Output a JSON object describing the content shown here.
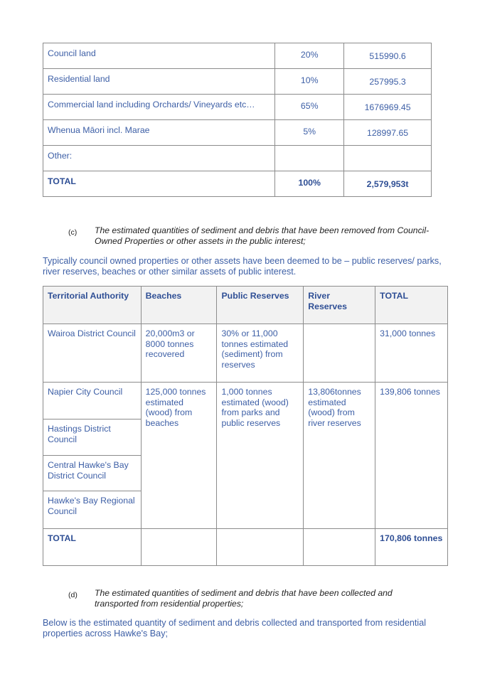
{
  "land_table": {
    "rows": [
      {
        "label": "Council land",
        "percent": "20%",
        "value": "515990.6"
      },
      {
        "label": "Residential land",
        "percent": "10%",
        "value": "257995.3"
      },
      {
        "label": "Commercial land including Orchards/ Vineyards etc…",
        "percent": "65%",
        "value": "1676969.45"
      },
      {
        "label": "Whenua Māori incl. Marae",
        "percent": "5%",
        "value": "128997.65"
      },
      {
        "label": "Other:",
        "percent": "",
        "value": ""
      }
    ],
    "total": {
      "label": "TOTAL",
      "percent": "100%",
      "value": "2,579,953t"
    }
  },
  "section_c": {
    "letter": "(c)",
    "heading": "The estimated quantities of sediment and debris that have been removed from Council-Owned Properties or other assets in the public interest;",
    "paragraph": "Typically council owned properties or other assets have been deemed to be – public reserves/ parks, river reserves, beaches or other similar assets of public interest."
  },
  "council_table": {
    "headers": [
      "Territorial Authority",
      "Beaches",
      "Public Reserves",
      "River Reserves",
      "TOTAL"
    ],
    "wairoa": {
      "authority": "Wairoa District Council",
      "beaches": "20,000m3 or 8000 tonnes recovered",
      "public_reserves": "30% or 11,000 tonnes estimated (sediment) from reserves",
      "river_reserves": "",
      "total": "31,000 tonnes"
    },
    "group": {
      "authorities": [
        "Napier City Council",
        "Hastings District Council",
        "Central Hawke's Bay District Council",
        "Hawke's Bay Regional Council"
      ],
      "beaches": "125,000 tonnes estimated (wood) from beaches",
      "public_reserves": "1,000 tonnes estimated (wood) from parks and public reserves",
      "river_reserves": "13,806tonnes estimated (wood) from river reserves",
      "total": "139,806 tonnes"
    },
    "total_row": {
      "label": "TOTAL",
      "total": "170,806 tonnes"
    }
  },
  "section_d": {
    "letter": "(d)",
    "heading": "The estimated quantities of sediment and debris that have been collected and transported from residential properties;",
    "paragraph": "Below is the estimated quantity of sediment and debris collected and transported from residential properties across Hawke's Bay;"
  }
}
